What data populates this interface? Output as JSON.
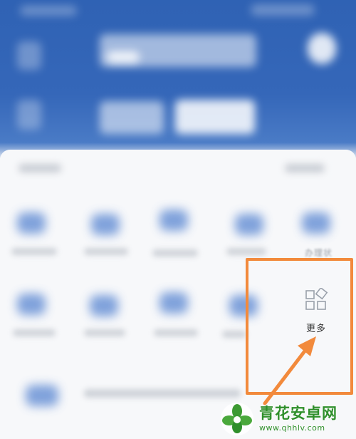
{
  "grid": {
    "partial_label": "办理状",
    "more": {
      "label": "更多",
      "icon": "grid-apps-icon"
    }
  },
  "annotation": {
    "color": "#f28a3c"
  },
  "colors": {
    "header_blue": "#3567b9",
    "accent_orange": "#f28a3c"
  },
  "watermark": {
    "name": "青花安卓网",
    "url": "www.qhhlv.com",
    "logo": "flower-logo"
  }
}
